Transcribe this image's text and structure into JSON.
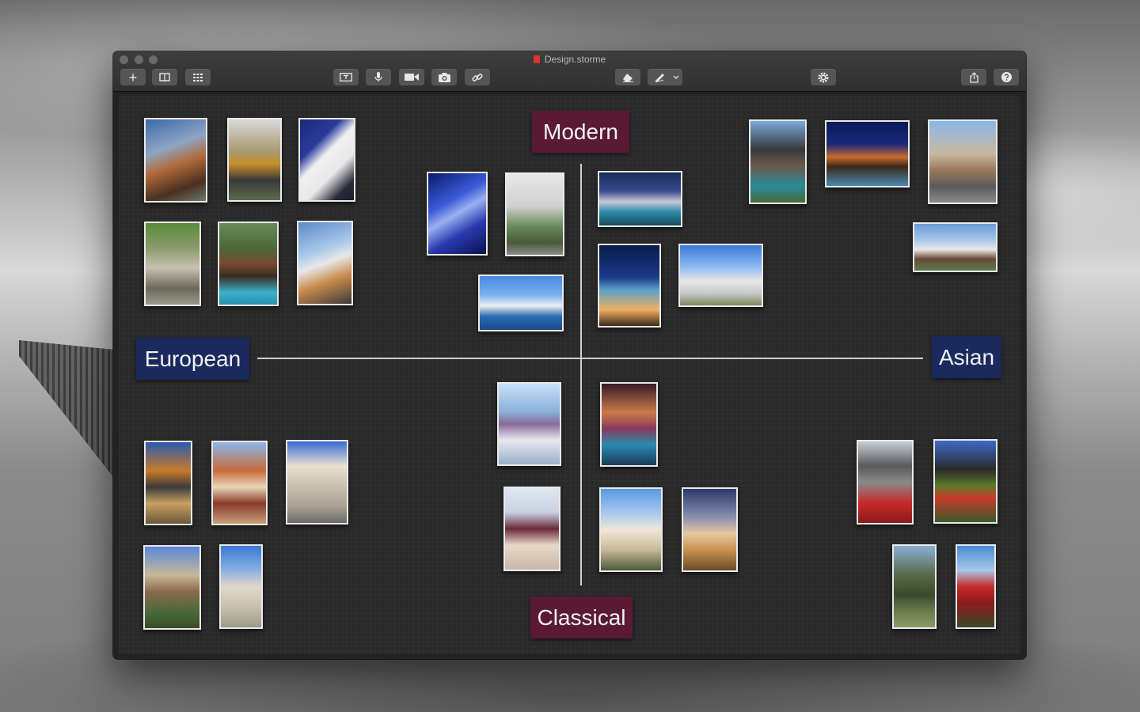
{
  "window": {
    "title": "Design.storme"
  },
  "toolbar": {
    "add_label": "+",
    "buttons": [
      "add",
      "book",
      "grid",
      "text",
      "microphone",
      "video",
      "camera",
      "link",
      "eraser",
      "pen",
      "settings",
      "share",
      "help"
    ]
  },
  "board": {
    "labels": {
      "top": "Modern",
      "bottom": "Classical",
      "left": "European",
      "right": "Asian"
    }
  },
  "colors": {
    "label_modern": "#5b1a33",
    "label_region": "#1a2a5e",
    "canvas": "#2a2a2a"
  }
}
